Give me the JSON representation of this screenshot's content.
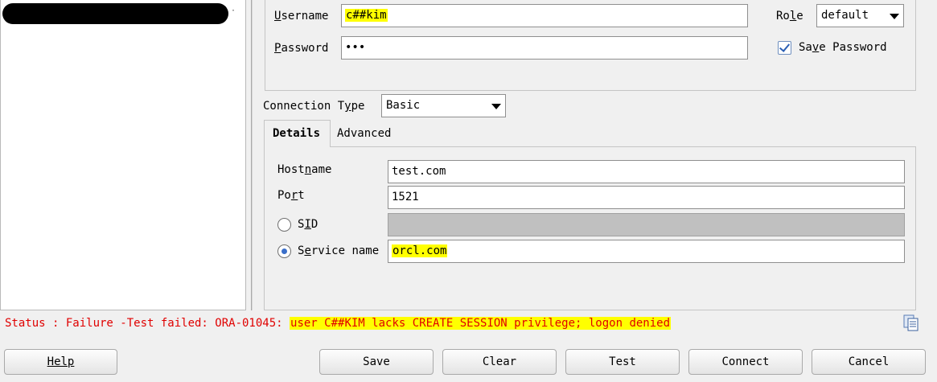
{
  "credentials": {
    "username_label": "Username",
    "username_value": "c##kim",
    "password_label": "Password",
    "password_value": "•••",
    "role_label": "Role",
    "role_value": "default",
    "save_password_label": "Save Password",
    "save_password_checked": true
  },
  "connection": {
    "type_label": "Connection Type",
    "type_value": "Basic"
  },
  "tabs": [
    {
      "label": "Details",
      "active": true
    },
    {
      "label": "Advanced",
      "active": false
    }
  ],
  "details": {
    "hostname_label": "Hostname",
    "hostname_value": "test.com",
    "port_label": "Port",
    "port_value": "1521",
    "sid_label": "SID",
    "sid_value": "",
    "service_name_label": "Service name",
    "service_name_value": "orcl.com",
    "selected": "service_name"
  },
  "status": {
    "prefix": "Status : Failure -Test failed: ORA-01045: ",
    "message": "user C##KIM lacks CREATE SESSION privilege; logon denied",
    "color": "#e00000"
  },
  "buttons": {
    "help": "Help",
    "save": "Save",
    "clear": "Clear",
    "test": "Test",
    "connect": "Connect",
    "cancel": "Cancel"
  },
  "colors": {
    "highlight": "#ffff00",
    "background": "#f0f0f0"
  }
}
